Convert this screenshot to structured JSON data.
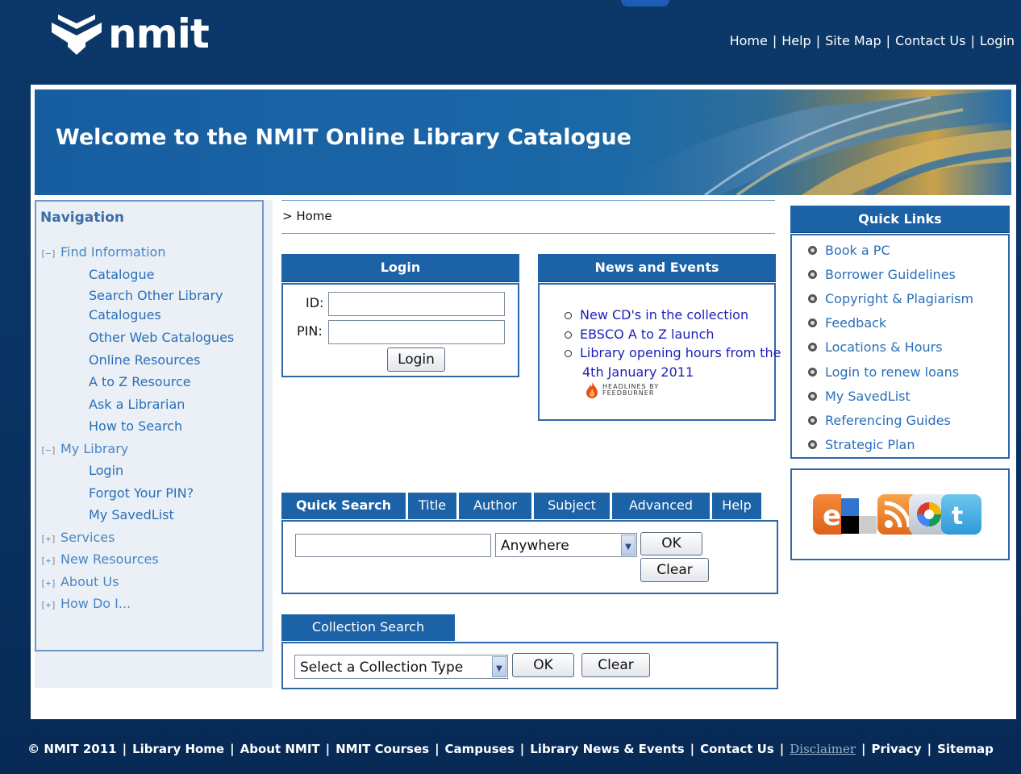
{
  "header": {
    "logo_text": "nmit",
    "nav": [
      "Home",
      "Help",
      "Site Map",
      "Contact Us",
      "Login"
    ]
  },
  "banner": {
    "title": "Welcome to the NMIT Online Library Catalogue"
  },
  "sidebar": {
    "title": "Navigation",
    "sections": [
      {
        "toggle": "[−]",
        "label": "Find Information",
        "items": [
          "Catalogue",
          "Search Other Library Catalogues",
          "Other Web Catalogues",
          "Online Resources",
          "A to Z Resource",
          "Ask a Librarian",
          "How to Search"
        ]
      },
      {
        "toggle": "[−]",
        "label": "My Library",
        "items": [
          "Login",
          "Forgot Your PIN?",
          "My SavedList"
        ]
      },
      {
        "toggle": "[+]",
        "label": "Services",
        "items": []
      },
      {
        "toggle": "[+]",
        "label": "New Resources",
        "items": []
      },
      {
        "toggle": "[+]",
        "label": "About Us",
        "items": []
      },
      {
        "toggle": "[+]",
        "label": "How Do I...",
        "items": []
      }
    ]
  },
  "breadcrumb": "> Home",
  "login": {
    "title": "Login",
    "id_label": "ID:",
    "pin_label": "PIN:",
    "id_value": "",
    "pin_value": "",
    "button": "Login"
  },
  "news": {
    "title": "News and Events",
    "items": [
      "New CD's in the collection",
      "EBSCO A to Z launch",
      "Library opening hours from the 4th January 2011"
    ],
    "feedburner": "HEADLINES BY FEEDBURNER"
  },
  "quick_search": {
    "tabs": [
      "Quick Search",
      "Title",
      "Author",
      "Subject",
      "Advanced",
      "Help"
    ],
    "active_tab": "Quick Search",
    "query": "",
    "scope": "Anywhere",
    "ok": "OK",
    "clear": "Clear"
  },
  "collection_search": {
    "title": "Collection Search",
    "select": "Select a Collection Type",
    "ok": "OK",
    "clear": "Clear"
  },
  "quick_links": {
    "title": "Quick Links",
    "items": [
      "Book a PC",
      "Borrower Guidelines",
      "Copyright & Plagiarism",
      "Feedback",
      "Locations & Hours",
      "Login to renew loans",
      "My SavedList",
      "Referencing Guides",
      "Strategic Plan"
    ]
  },
  "social_icons": [
    "blogger-icon",
    "delicious-icon",
    "rss-icon",
    "picasa-icon",
    "twitter-icon"
  ],
  "footer": {
    "items": [
      "© NMIT 2011",
      "Library Home",
      "About NMIT",
      "NMIT Courses",
      "Campuses",
      "Library News & Events",
      "Contact Us",
      "Disclaimer",
      "Privacy",
      "Sitemap"
    ]
  },
  "colors": {
    "header_bg": "#0a3566",
    "tab_bg": "#1c62a6",
    "link": "#2a6fb8",
    "news_link": "#1d1dbb"
  }
}
